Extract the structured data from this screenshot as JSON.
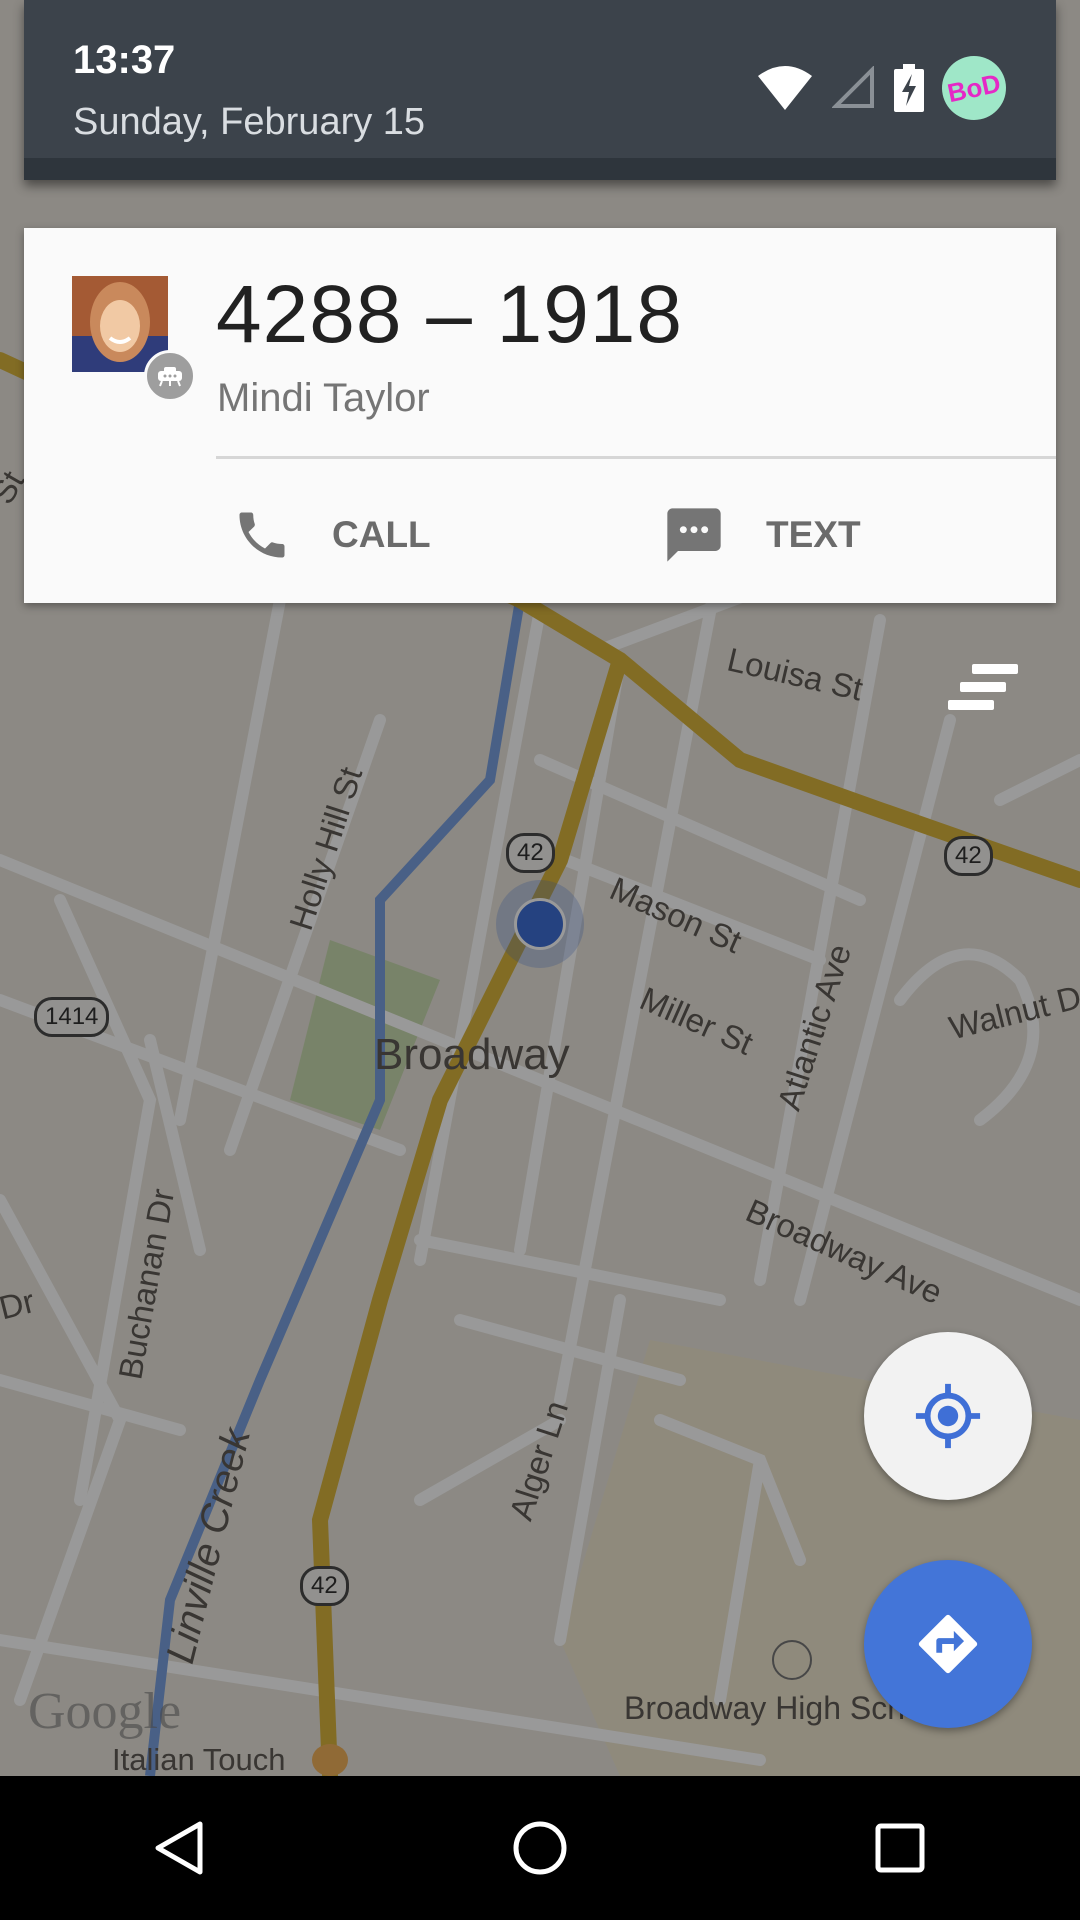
{
  "status_bar": {
    "time": "13:37",
    "date": "Sunday, February 15",
    "icons": [
      "wifi-icon",
      "cell-signal-icon",
      "battery-charging-icon"
    ],
    "user_avatar_text": "BoD"
  },
  "notification": {
    "phone_number": "4288 – 1918",
    "contact_name": "Mindi Taylor",
    "actions": [
      {
        "label": "CALL",
        "icon": "phone-icon"
      },
      {
        "label": "TEXT",
        "icon": "message-icon"
      }
    ]
  },
  "map": {
    "street_labels": [
      "Louisa St",
      "Holly Hill St",
      "Mason St",
      "Miller St",
      "Atlantic Ave",
      "Walnut D",
      "Broadway",
      "Broadway Ave",
      "Buchanan Dr",
      "Linville Creek",
      "Alger Ln",
      "Dr",
      "St",
      "Broadway High Sch",
      "Italian Touch"
    ],
    "route_shields": [
      "42",
      "42",
      "1414",
      "42"
    ],
    "attribution": "Google"
  },
  "colors": {
    "shade": "#3c434b",
    "card": "#fafafa",
    "fab_blue": "#4375d8",
    "road_yellow": "#e8c34a",
    "creek_blue": "#7aa0e0"
  }
}
